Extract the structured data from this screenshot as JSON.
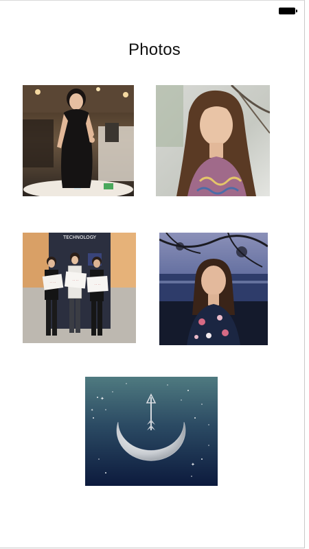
{
  "status_bar": {
    "battery_icon": "battery-full-icon"
  },
  "header": {
    "title": "Photos"
  },
  "photos": [
    {
      "name": "portrait-woman-black-dress",
      "kind": "photo"
    },
    {
      "name": "portrait-woman-long-hair-outdoors",
      "kind": "photo"
    },
    {
      "name": "three-women-holding-signs",
      "kind": "photo",
      "sign_text": "TECHNOLOGY"
    },
    {
      "name": "portrait-woman-floral-top-by-water",
      "kind": "photo"
    },
    {
      "name": "crescent-moon-arrow-logo",
      "kind": "graphic"
    }
  ],
  "colors": {
    "background": "#ffffff",
    "title": "#111111",
    "logo_bg_top": "#4f7a80",
    "logo_bg_bottom": "#0c1a3d"
  }
}
